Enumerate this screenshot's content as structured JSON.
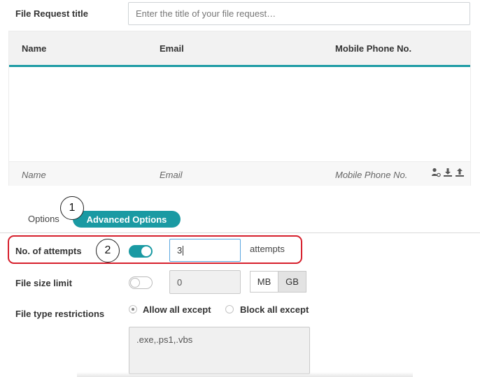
{
  "title_row": {
    "label": "File Request title",
    "placeholder": "Enter the title of your file request…"
  },
  "table": {
    "headers": [
      "Name",
      "Email",
      "Mobile Phone No."
    ],
    "footer_placeholders": [
      "Name",
      "Email",
      "Mobile Phone No."
    ],
    "action_icons": [
      "add-contact-icon",
      "download-icon",
      "upload-icon"
    ]
  },
  "tabs": [
    {
      "label": "Options",
      "active": false
    },
    {
      "label": "Advanced Options",
      "active": true
    }
  ],
  "callouts": [
    "1",
    "2"
  ],
  "attempts": {
    "label": "No. of attempts",
    "enabled": true,
    "value": "3",
    "unit": "attempts"
  },
  "file_size": {
    "label": "File size limit",
    "enabled": false,
    "value": "0",
    "units": [
      "MB",
      "GB"
    ],
    "selected_unit": "GB"
  },
  "file_types": {
    "label": "File type restrictions",
    "options": [
      "Allow all except",
      "Block all except"
    ],
    "selected": "Allow all except",
    "list": ".exe,.ps1,.vbs"
  },
  "colors": {
    "accent": "#1a9aa3",
    "highlight_border": "#d61f2c"
  }
}
